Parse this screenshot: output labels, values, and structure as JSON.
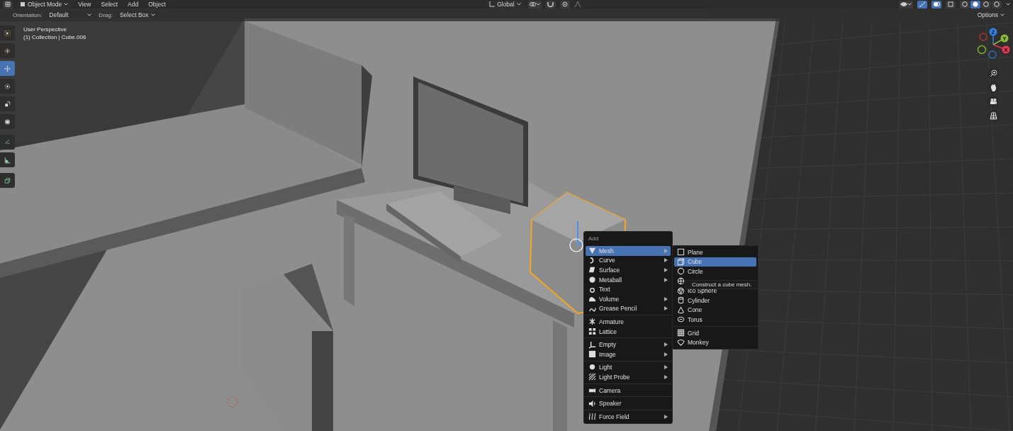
{
  "header": {
    "mode": "Object Mode",
    "menus": [
      "View",
      "Select",
      "Add",
      "Object"
    ],
    "orientation": "Global"
  },
  "shading": [
    {
      "selected": false
    },
    {
      "selected": true
    },
    {
      "selected": false
    },
    {
      "selected": false
    }
  ],
  "tool_settings": {
    "orientation_label": "Orientation:",
    "orientation": "Default",
    "drag_label": "Drag:",
    "drag": "Select Box",
    "options": "Options"
  },
  "toolbar": [
    {
      "selected": false
    },
    {
      "selected": false
    },
    {
      "selected": true
    },
    {
      "selected": false
    },
    {
      "selected": false
    },
    {
      "selected": false
    },
    {
      "selected": false
    },
    {
      "selected": false
    },
    {
      "selected": false
    }
  ],
  "viewport": {
    "view_name": "User Perspective",
    "object_info": "(1) Collection | Cube.006"
  },
  "gizmo": {
    "axis_labels": [
      "Z",
      "Y",
      "X"
    ]
  },
  "add_menu": {
    "title": "Add",
    "groups": [
      [
        {
          "label": "Mesh",
          "submenu": true,
          "selected": true
        },
        {
          "label": "Curve",
          "submenu": true,
          "selected": false
        },
        {
          "label": "Surface",
          "submenu": true,
          "selected": false
        },
        {
          "label": "Metaball",
          "submenu": true,
          "selected": false
        },
        {
          "label": "Text",
          "submenu": false,
          "selected": false
        },
        {
          "label": "Volume",
          "submenu": true,
          "selected": false
        },
        {
          "label": "Grease Pencil",
          "submenu": true,
          "selected": false
        }
      ],
      [
        {
          "label": "Armature",
          "submenu": false,
          "selected": false
        },
        {
          "label": "Lattice",
          "submenu": false,
          "selected": false
        }
      ],
      [
        {
          "label": "Empty",
          "submenu": true,
          "selected": false
        },
        {
          "label": "Image",
          "submenu": true,
          "selected": false
        }
      ],
      [
        {
          "label": "Light",
          "submenu": true,
          "selected": false
        },
        {
          "label": "Light Probe",
          "submenu": true,
          "selected": false
        }
      ],
      [
        {
          "label": "Camera",
          "submenu": false,
          "selected": false
        }
      ],
      [
        {
          "label": "Speaker",
          "submenu": false,
          "selected": false
        }
      ],
      [
        {
          "label": "Force Field",
          "submenu": true,
          "selected": false
        }
      ]
    ]
  },
  "mesh_menu": {
    "groups": [
      [
        {
          "label": "Plane",
          "selected": false
        },
        {
          "label": "Cube",
          "selected": true
        },
        {
          "label": "Circle",
          "selected": false
        },
        {
          "selected": false
        },
        {
          "label": "Ico Sphere",
          "selected": false
        },
        {
          "label": "Cylinder",
          "selected": false
        },
        {
          "label": "Cone",
          "selected": false
        },
        {
          "label": "Torus",
          "selected": false
        }
      ],
      [
        {
          "label": "Grid",
          "selected": false
        },
        {
          "label": "Monkey",
          "selected": false
        }
      ]
    ]
  },
  "tooltip": "Construct a cube mesh."
}
